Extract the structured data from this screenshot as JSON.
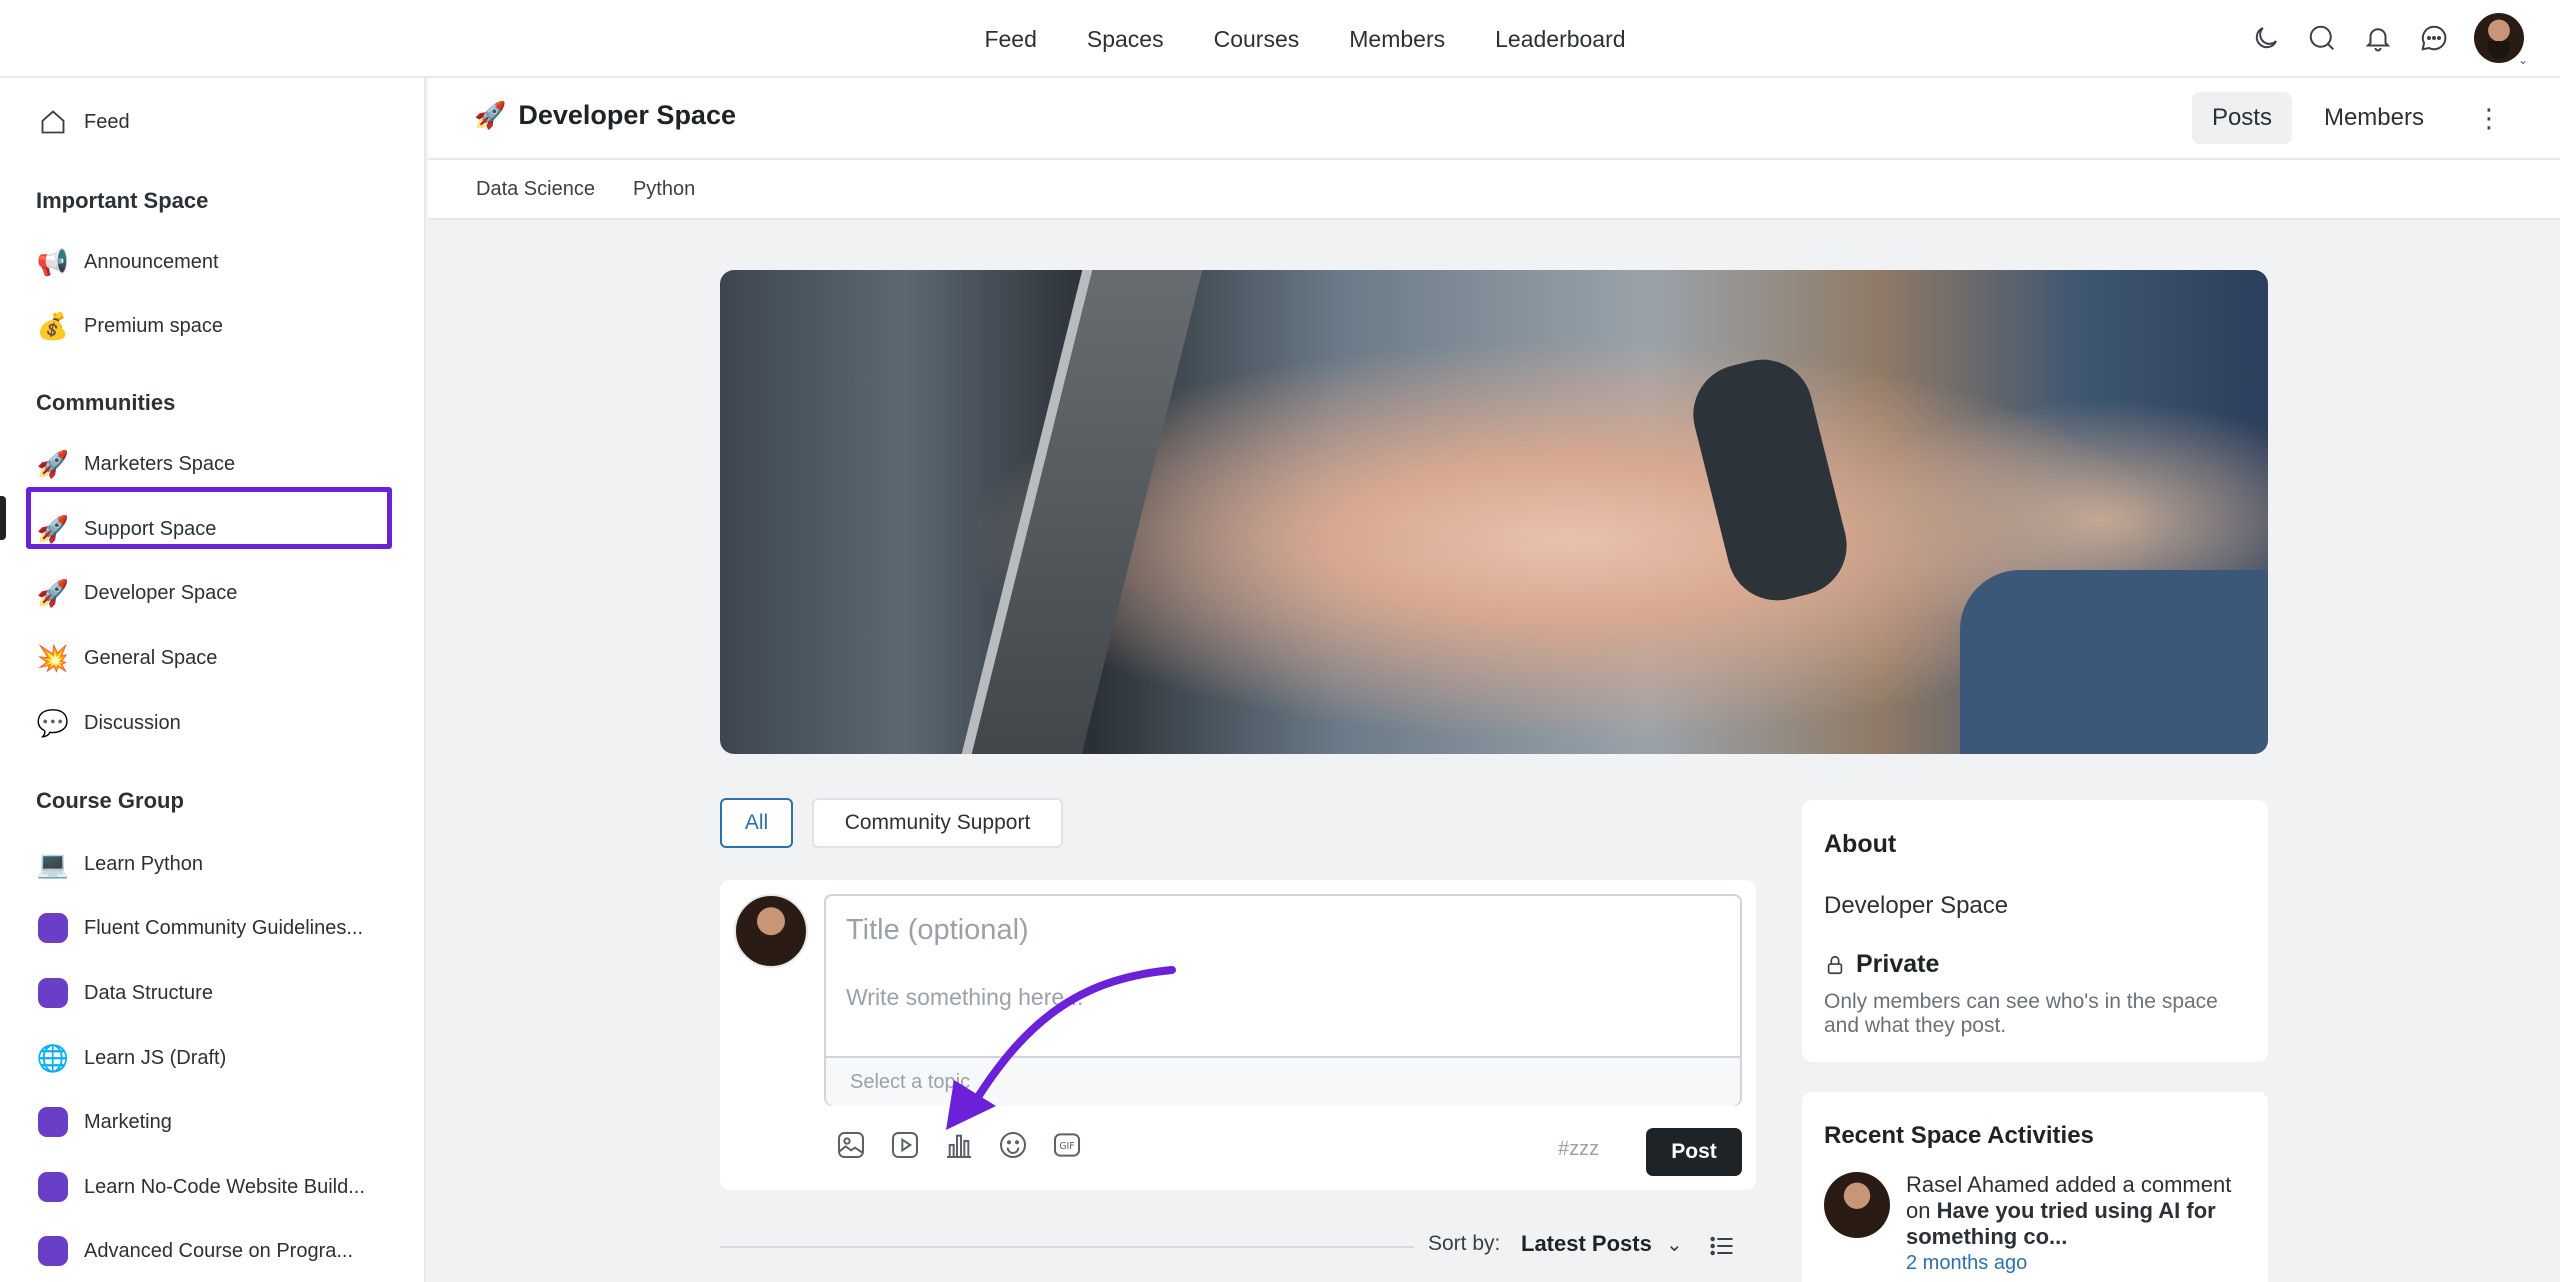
{
  "topnav": {
    "links": [
      "Feed",
      "Spaces",
      "Courses",
      "Members",
      "Leaderboard"
    ],
    "icons": [
      "moon-icon",
      "search-icon",
      "bell-icon",
      "chat-icon"
    ]
  },
  "sidebar": {
    "feed": "Feed",
    "important_heading": "Important Space",
    "important": [
      {
        "label": "Announcement",
        "icon": "📢"
      },
      {
        "label": "Premium space",
        "icon": "💰"
      }
    ],
    "communities_heading": "Communities",
    "communities": [
      {
        "label": "Marketers Space",
        "icon": "🚀"
      },
      {
        "label": "Support Space",
        "icon": "🚀"
      },
      {
        "label": "Developer Space",
        "icon": "🚀"
      },
      {
        "label": "General Space",
        "icon": "💥"
      },
      {
        "label": "Discussion",
        "icon": "💬"
      }
    ],
    "courses_heading": "Course Group",
    "courses": [
      {
        "label": "Learn Python",
        "icon": "💻"
      },
      {
        "label": "Fluent Community Guidelines...",
        "icon": ""
      },
      {
        "label": "Data Structure",
        "icon": ""
      },
      {
        "label": "Learn JS (Draft)",
        "icon": "🌐"
      },
      {
        "label": "Marketing",
        "icon": ""
      },
      {
        "label": "Learn No-Code Website Build...",
        "icon": ""
      },
      {
        "label": "Advanced Course on Progra...",
        "icon": ""
      }
    ]
  },
  "space": {
    "icon": "🚀",
    "title": "Developer Space",
    "tab_posts": "Posts",
    "tab_members": "Members",
    "subnav": [
      "Data Science",
      "Python"
    ]
  },
  "filters": {
    "all": "All",
    "community": "Community Support"
  },
  "composer": {
    "title_placeholder": "Title (optional)",
    "body_placeholder": "Write something here...",
    "topic_placeholder": "Select a topic",
    "hashtag": "#zzz",
    "post": "Post"
  },
  "sort": {
    "label": "Sort by:",
    "value": "Latest Posts"
  },
  "about": {
    "heading": "About",
    "name": "Developer Space",
    "privacy": "Private",
    "description": "Only members can see who's in the space and what they post."
  },
  "recent": {
    "heading": "Recent Space Activities",
    "user": "Rasel Ahamed",
    "action": "added a comment on",
    "post": "Have you tried using AI for something co...",
    "time": "2 months ago"
  },
  "colors": {
    "accent": "#6a21d8",
    "link": "#2f6fab",
    "dark": "#1d2327"
  }
}
